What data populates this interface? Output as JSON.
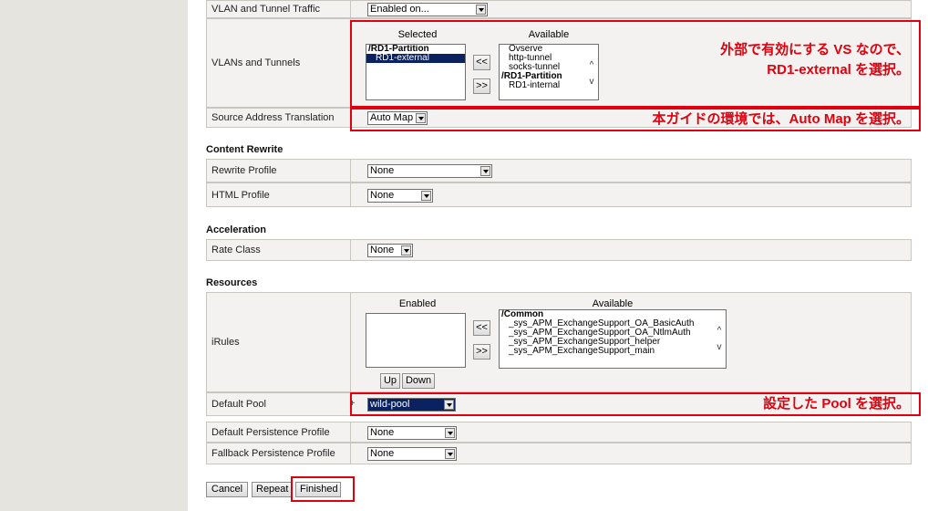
{
  "vlan_tunnel_traffic": {
    "label": "VLAN and Tunnel Traffic",
    "value": "Enabled on..."
  },
  "vlans_tunnels": {
    "label": "VLANs and Tunnels",
    "selected_header": "Selected",
    "available_header": "Available",
    "selected_items": [
      "/RD1-Partition",
      "RD1-external"
    ],
    "available_items": [
      "Ovserve",
      "http-tunnel",
      "socks-tunnel",
      "/RD1-Partition",
      "RD1-internal"
    ],
    "move_left": "<<",
    "move_right": ">>"
  },
  "source_address_translation": {
    "label": "Source Address Translation",
    "value": "Auto Map"
  },
  "content_rewrite": {
    "heading": "Content Rewrite",
    "rewrite_profile": {
      "label": "Rewrite Profile",
      "value": "None"
    },
    "html_profile": {
      "label": "HTML Profile",
      "value": "None"
    }
  },
  "acceleration": {
    "heading": "Acceleration",
    "rate_class": {
      "label": "Rate Class",
      "value": "None"
    }
  },
  "resources": {
    "heading": "Resources",
    "irules": {
      "label": "iRules",
      "enabled_header": "Enabled",
      "available_header": "Available",
      "available_items": [
        "/Common",
        "_sys_APM_ExchangeSupport_OA_BasicAuth",
        "_sys_APM_ExchangeSupport_OA_NtlmAuth",
        "_sys_APM_ExchangeSupport_helper",
        "_sys_APM_ExchangeSupport_main"
      ],
      "move_left": "<<",
      "move_right": ">>",
      "up": "Up",
      "down": "Down"
    },
    "default_pool": {
      "label": "Default Pool",
      "plus": "+",
      "value": "wild-pool"
    },
    "default_persistence": {
      "label": "Default Persistence Profile",
      "value": "None"
    },
    "fallback_persistence": {
      "label": "Fallback Persistence Profile",
      "value": "None"
    }
  },
  "buttons": {
    "cancel": "Cancel",
    "repeat": "Repeat",
    "finished": "Finished"
  },
  "annotations": {
    "vlan_note_line1": "外部で有効にする VS なので、",
    "vlan_note_line2": "RD1-external を選択。",
    "snat_note": "本ガイドの環境では、Auto Map を選択。",
    "pool_note": "設定した Pool を選択。"
  },
  "colors": {
    "annotation_red": "#e0000e",
    "selection_blue": "#0b2260",
    "sidebar": "#e5e4df"
  }
}
